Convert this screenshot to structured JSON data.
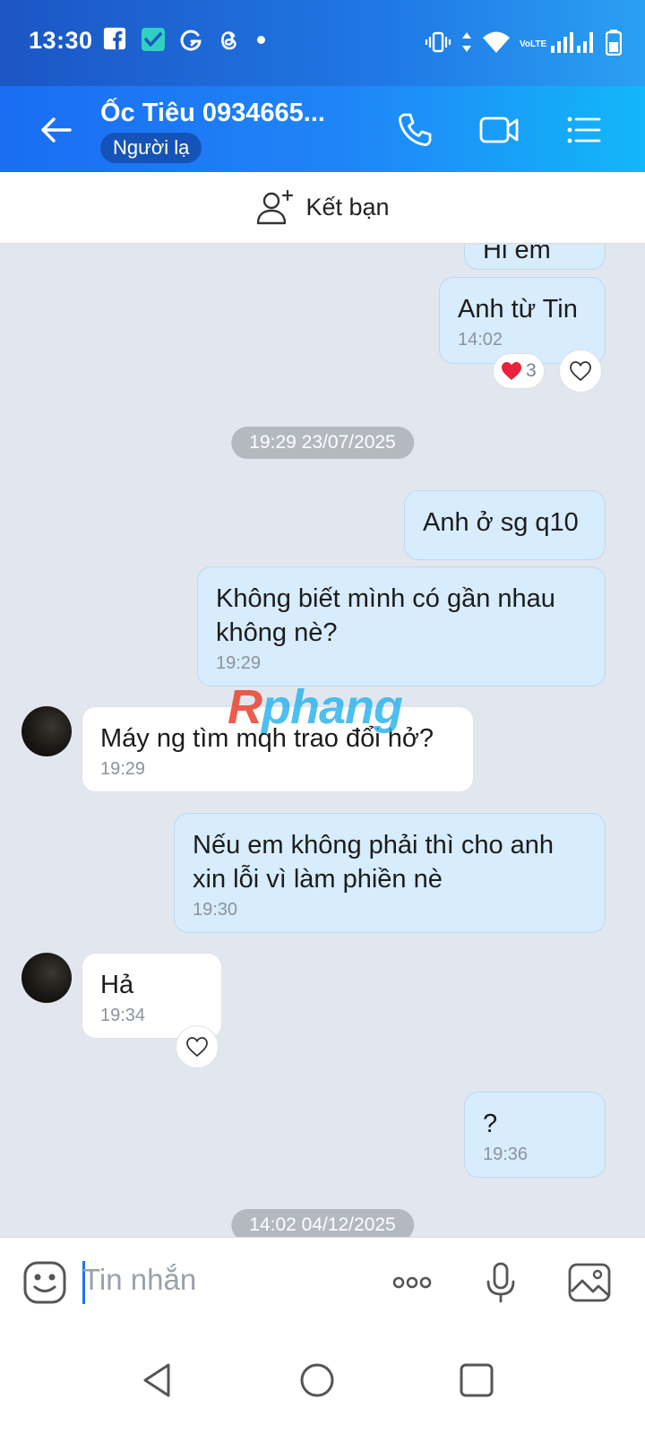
{
  "status_bar": {
    "time": "13:30",
    "left_icons": [
      "facebook-icon",
      "messenger-app-icon",
      "grammarly-icon",
      "threads-icon",
      "dot-icon"
    ],
    "right_icons": [
      "vibrate-icon",
      "data-arrows-icon",
      "wifi-icon",
      "volte-icon",
      "signal-icon",
      "battery-icon"
    ],
    "volte_label": "VoLTE"
  },
  "header": {
    "contact_name": "Ốc Tiêu 0934665...",
    "badge": "Người lạ",
    "accent_color": "#1f86f7"
  },
  "friend_bar": {
    "label": "Kết bạn"
  },
  "messages": [
    {
      "side": "out",
      "text": "Hi em",
      "time": ""
    },
    {
      "side": "out",
      "text": "Anh từ Tin",
      "time": "14:02",
      "reaction": {
        "icon": "red-heart-icon",
        "count": "3"
      }
    },
    {
      "date_divider": "19:29 23/07/2025"
    },
    {
      "side": "out",
      "text": "Anh ở sg q10",
      "time": ""
    },
    {
      "side": "out",
      "text": "Không biết mình có gần nhau không nè?",
      "time": "19:29"
    },
    {
      "side": "in",
      "text": "Máy ng tìm mqh trao đổi hở?",
      "time": "19:29"
    },
    {
      "side": "out",
      "text": "Nếu em không phải thì cho anh xin lỗi vì làm phiền nè",
      "time": "19:30"
    },
    {
      "side": "in",
      "text": "Hả",
      "time": "19:34"
    },
    {
      "side": "out",
      "text": "?",
      "time": "19:36"
    },
    {
      "date_divider": "14:02 04/12/2025"
    }
  ],
  "watermark": {
    "first": "R",
    "rest": "phang"
  },
  "input_bar": {
    "placeholder": "Tin nhắn",
    "icons": [
      "sticker-icon",
      "more-icon",
      "microphone-icon",
      "image-icon"
    ]
  },
  "nav_bar": {
    "icons": [
      "back-triangle-icon",
      "home-circle-icon",
      "recents-square-icon"
    ]
  }
}
